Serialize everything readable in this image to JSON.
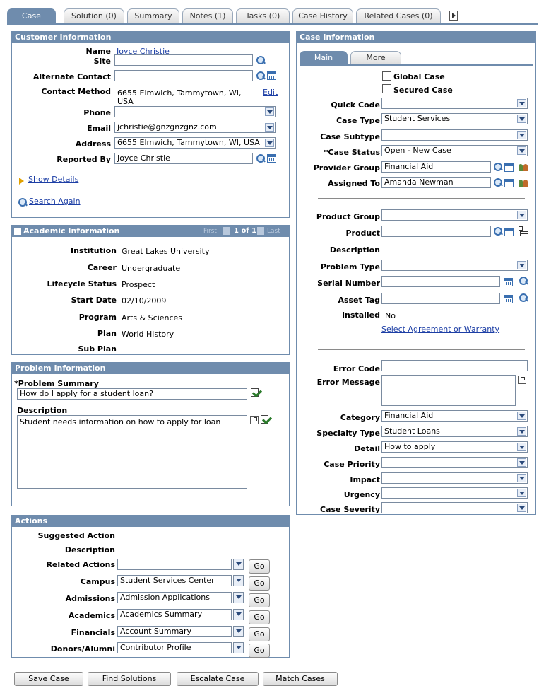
{
  "tabs": [
    "Case",
    "Solution (0)",
    "Summary",
    "Notes (1)",
    "Tasks (0)",
    "Case History",
    "Related Cases (0)"
  ],
  "customer": {
    "title": "Customer Information",
    "name_label": "Name",
    "name_value": "Joyce Christie",
    "site_label": "Site",
    "alt_contact_label": "Alternate Contact",
    "contact_method_label": "Contact Method",
    "contact_method_value1": "6655 Elmwich, Tammytown, WI,",
    "contact_method_value2": "USA",
    "edit_link": "Edit",
    "phone_label": "Phone",
    "email_label": "Email",
    "email_value": "jchristie@gnzgnzgnz.com",
    "address_label": "Address",
    "address_value": "6655 Elmwich, Tammytown, WI, USA",
    "reported_by_label": "Reported By",
    "reported_by_value": "Joyce Christie",
    "show_details": "Show Details",
    "search_again": "Search Again"
  },
  "academic": {
    "title": "Academic Information",
    "nav_first": "First",
    "nav_count": "1 of 1",
    "nav_last": "Last",
    "rows": [
      {
        "label": "Institution",
        "value": "Great Lakes University"
      },
      {
        "label": "Career",
        "value": "Undergraduate"
      },
      {
        "label": "Lifecycle Status",
        "value": "Prospect"
      },
      {
        "label": "Start Date",
        "value": "02/10/2009"
      },
      {
        "label": "Program",
        "value": "Arts & Sciences"
      },
      {
        "label": "Plan",
        "value": "World History"
      },
      {
        "label": "Sub Plan",
        "value": ""
      }
    ]
  },
  "problem": {
    "title": "Problem Information",
    "summary_label": "*Problem Summary",
    "summary_value": "How do I apply for a student loan?",
    "description_label": "Description",
    "description_value": "Student needs information on how to apply for loan"
  },
  "actions": {
    "title": "Actions",
    "suggested_label": "Suggested Action",
    "description_label": "Description",
    "go": "Go",
    "rows": [
      {
        "label": "Related Actions",
        "value": ""
      },
      {
        "label": "Campus",
        "value": "Student Services Center"
      },
      {
        "label": "Admissions",
        "value": "Admission Applications"
      },
      {
        "label": "Academics",
        "value": "Academics Summary"
      },
      {
        "label": "Financials",
        "value": "Account Summary"
      },
      {
        "label": "Donors/Alumni",
        "value": "Contributor Profile"
      }
    ]
  },
  "case": {
    "title": "Case Information",
    "subtabs": [
      "Main",
      "More"
    ],
    "global_case": "Global Case",
    "secured_case": "Secured Case",
    "quick_code_label": "Quick Code",
    "case_type_label": "Case Type",
    "case_type_value": "Student Services",
    "case_subtype_label": "Case Subtype",
    "case_status_label": "*Case Status",
    "case_status_value": "Open - New Case",
    "provider_group_label": "Provider Group",
    "provider_group_value": "Financial Aid",
    "assigned_to_label": "Assigned To",
    "assigned_to_value": "Amanda Newman",
    "product_group_label": "Product Group",
    "product_label": "Product",
    "description_label": "Description",
    "problem_type_label": "Problem Type",
    "serial_number_label": "Serial Number",
    "asset_tag_label": "Asset Tag",
    "installed_label": "Installed",
    "installed_value": "No",
    "select_agreement": "Select Agreement or Warranty",
    "error_code_label": "Error Code",
    "error_message_label": "Error Message",
    "category_label": "Category",
    "category_value": "Financial Aid",
    "specialty_type_label": "Specialty Type",
    "specialty_type_value": "Student Loans",
    "detail_label": "Detail",
    "detail_value": "How to apply",
    "case_priority_label": "Case Priority",
    "impact_label": "Impact",
    "urgency_label": "Urgency",
    "case_severity_label": "Case Severity"
  },
  "buttons": {
    "save_case": "Save Case",
    "find_solutions": "Find Solutions",
    "escalate_case": "Escalate Case",
    "match_cases": "Match Cases"
  },
  "icons": [
    "search-icon",
    "calendar-icon",
    "spell-check-icon",
    "zoom-icon",
    "people-icon",
    "tree-icon",
    "triangle-icon",
    "next-tab-icon"
  ]
}
